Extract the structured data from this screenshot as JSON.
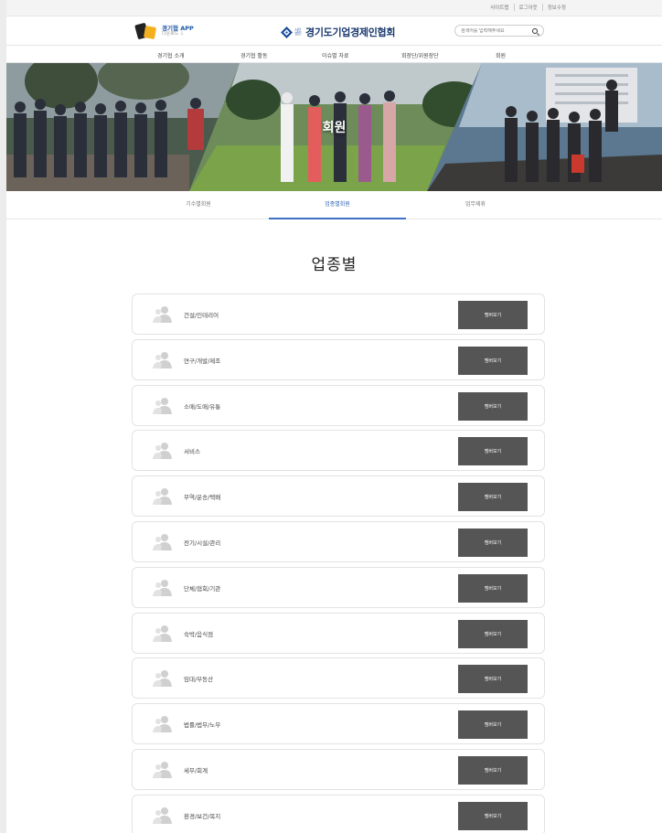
{
  "util_links": [
    "사이트맵",
    "로그아웃",
    "정보수정"
  ],
  "app": {
    "title": "경기협 APP",
    "sub": "다운로드 ⇩"
  },
  "logo": {
    "mini": "사단법인",
    "text": "경기도기업경제인협회"
  },
  "search": {
    "placeholder": "검색어를 입력해주세요"
  },
  "gnb": [
    "경기협 소개",
    "경기협 활동",
    "이슈별 자료",
    "회장단/위원장단",
    "회원"
  ],
  "hero": {
    "title": "회원"
  },
  "tabs": [
    {
      "label": "기수별회원",
      "active": false
    },
    {
      "label": "업종별회원",
      "active": true
    },
    {
      "label": "업무제휴",
      "active": false
    }
  ],
  "section": {
    "title": "업종별"
  },
  "categories": [
    {
      "label": "건설/인테리어",
      "button": "멤버보기"
    },
    {
      "label": "연구/개발/제조",
      "button": "멤버보기"
    },
    {
      "label": "소매/도매/유통",
      "button": "멤버보기"
    },
    {
      "label": "서비스",
      "button": "멤버보기"
    },
    {
      "label": "무역/운송/택배",
      "button": "멤버보기"
    },
    {
      "label": "전기/시설/관리",
      "button": "멤버보기"
    },
    {
      "label": "단체/협회/기관",
      "button": "멤버보기"
    },
    {
      "label": "숙박/음식점",
      "button": "멤버보기"
    },
    {
      "label": "임대/부동산",
      "button": "멤버보기"
    },
    {
      "label": "법률/법무/노무",
      "button": "멤버보기"
    },
    {
      "label": "세무/회계",
      "button": "멤버보기"
    },
    {
      "label": "환경/보건/복지",
      "button": "멤버보기"
    }
  ],
  "colors": {
    "accent": "#3d72c2",
    "button": "#555555",
    "logo": "#1b3a6f"
  }
}
